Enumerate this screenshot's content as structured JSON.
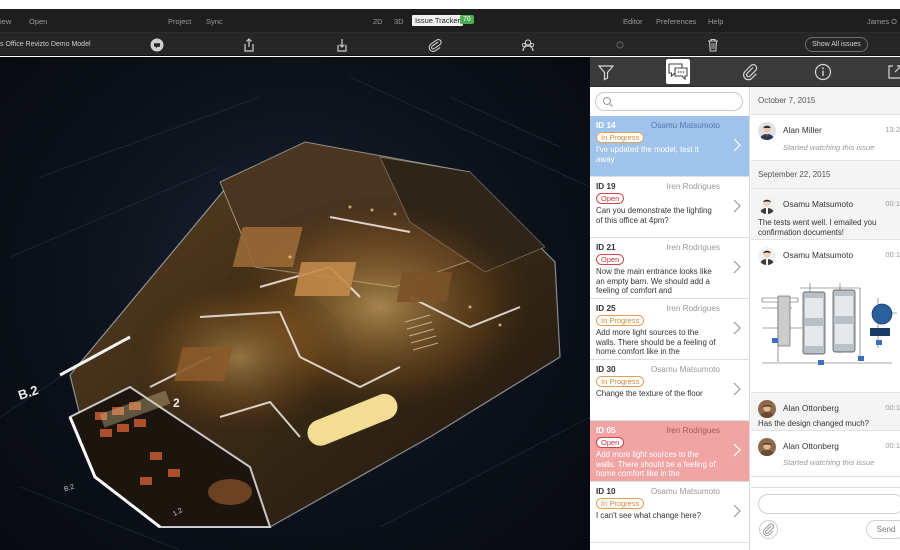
{
  "menubar": {
    "view": "iew",
    "open": "Open",
    "project": "Project",
    "sync": "Sync",
    "mode_2d": "2D",
    "mode_3d": "3D",
    "issue_tracker": "Issue Tracker",
    "issue_count": "76",
    "editor": "Editor",
    "preferences": "Preferences",
    "help": "Help",
    "user": "James O"
  },
  "toolbar": {
    "model_name": "s Office Revizto Demo Model",
    "show_all": "Show All issues"
  },
  "viewport": {
    "label_b2_large": "B.2",
    "label_b2_small": "B.2",
    "label_2": "2",
    "label_12": "1.2"
  },
  "issues": {
    "search_placeholder": "",
    "items": [
      {
        "id": "ID 14",
        "user": "Osamu Matsumoto",
        "status": "In Progress",
        "status_kind": "progress",
        "text": "I've updated the model, test it away",
        "state": "selected"
      },
      {
        "id": "ID 19",
        "user": "Iren Rodrigues",
        "status": "Open",
        "status_kind": "open",
        "text": "Can you demonstrate the lighting of this office at 4pm?",
        "state": "normal"
      },
      {
        "id": "ID 21",
        "user": "Iren Rodrigues",
        "status": "Open",
        "status_kind": "open",
        "text": "Now the main entrance looks like an empty barn. We should add a feeling of comfort and",
        "state": "normal"
      },
      {
        "id": "ID 25",
        "user": "Iren Rodrigues",
        "status": "In Progress",
        "status_kind": "progress",
        "text": "Add more light sources to the walls. There should be a feeling of home comfort like in the",
        "state": "normal"
      },
      {
        "id": "ID 30",
        "user": "Osamu Matsumoto",
        "status": "In Progress",
        "status_kind": "progress",
        "text": "Change the texture of the floor",
        "state": "normal"
      },
      {
        "id": "ID 05",
        "user": "Iren Rodrigues",
        "status": "Open",
        "status_kind": "open",
        "text": "Add more light sources to the walls. There should be a feeling of home comfort like in the",
        "state": "red"
      },
      {
        "id": "ID 10",
        "user": "Osamu Matsumoto",
        "status": "In Progress",
        "status_kind": "progress",
        "text": "I can't see what change here?",
        "state": "normal"
      }
    ]
  },
  "chat": {
    "date1": "October 7, 2015",
    "msg1": {
      "name": "Alan Miller",
      "time": "13:2",
      "system": "Started watching this issue"
    },
    "date2": "September 22, 2015",
    "msg2": {
      "name": "Osamu Matsumoto",
      "time": "00:1",
      "text": "The tests went well. I emailed you confirmation documents!"
    },
    "msg3": {
      "name": "Osamu Matsumoto",
      "time": "00:1"
    },
    "msg4": {
      "name": "Alan Ottonberg",
      "time": "00:1",
      "text": "Has the design changed much?"
    },
    "msg5": {
      "name": "Alan Ottonberg",
      "time": "00:1",
      "system": "Started watching this issue"
    },
    "send": "Send"
  },
  "colors": {
    "selected_issue": "#9fc3ea",
    "red_issue": "#f0a4a4",
    "status_open": "#c03c3c",
    "status_progress": "#d28a3e",
    "badge": "#4cae4c"
  }
}
